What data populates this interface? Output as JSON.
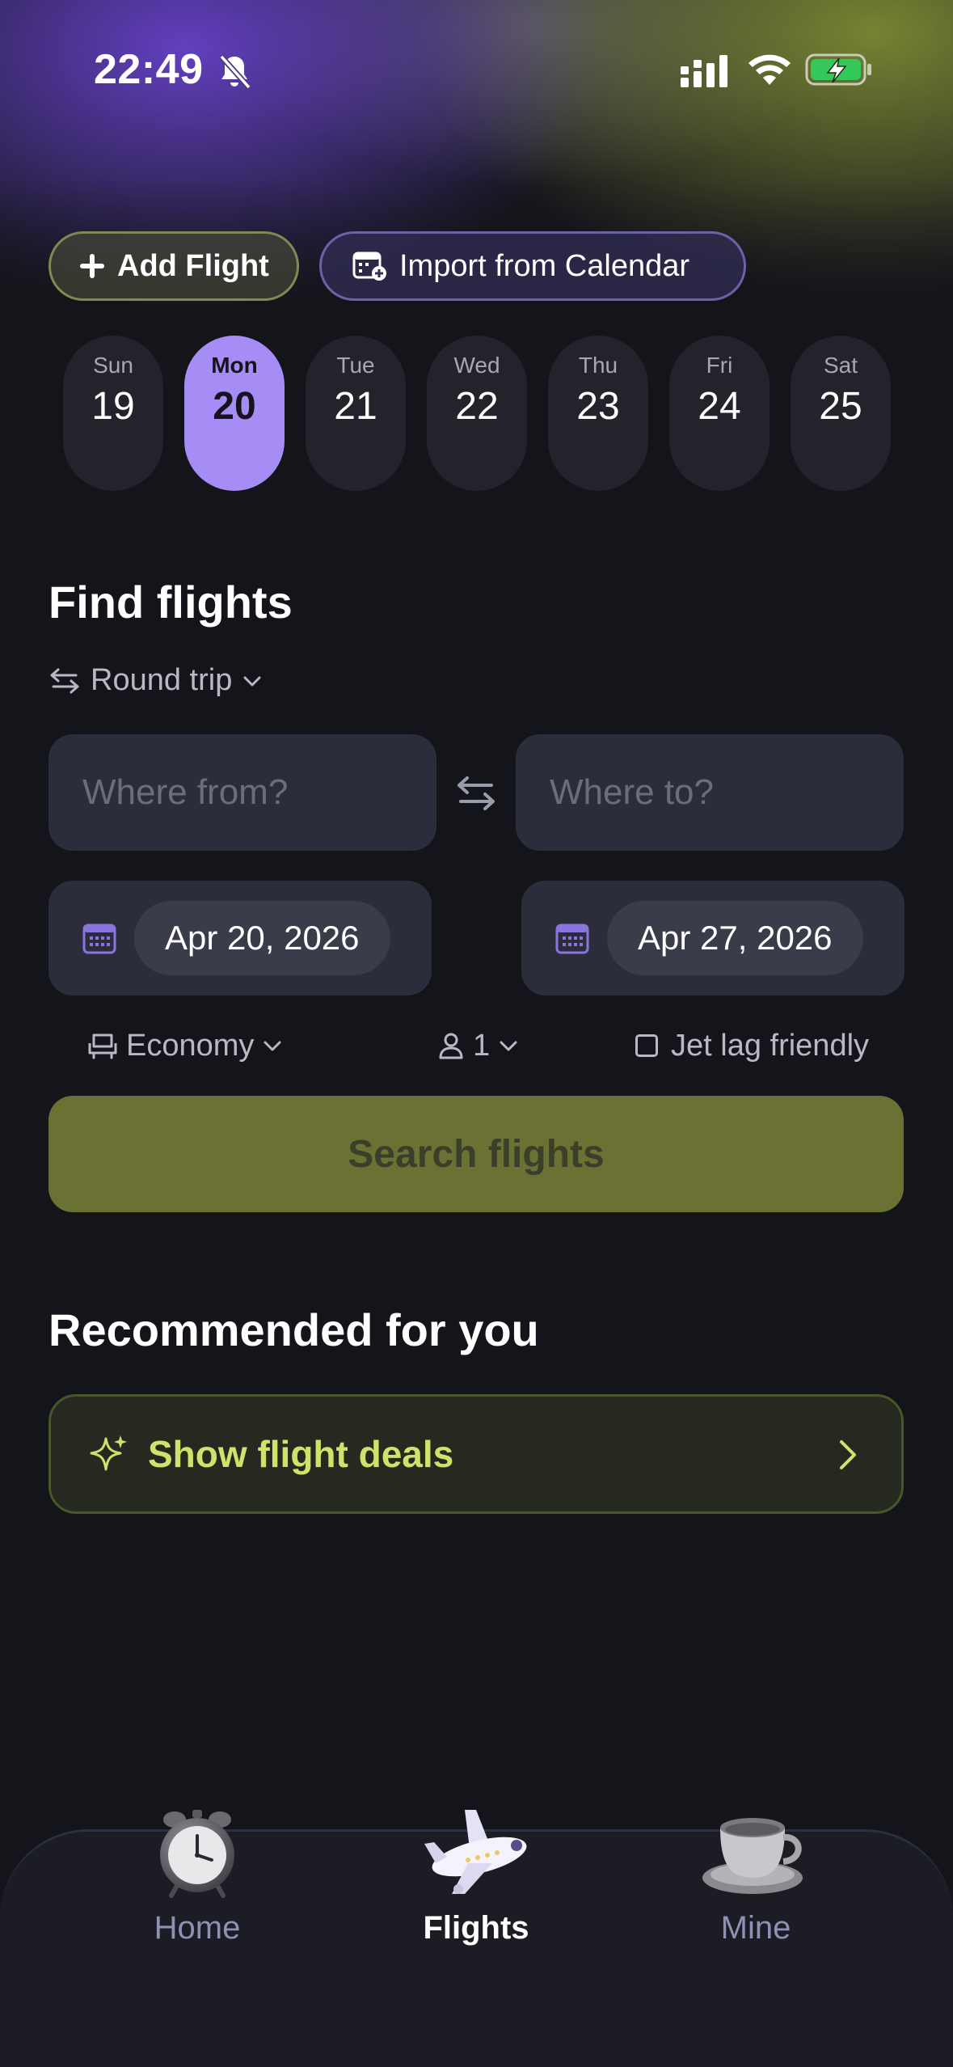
{
  "status_bar": {
    "time": "22:49",
    "icons": [
      "bell-slash-icon",
      "signal-icon",
      "wifi-icon",
      "battery-charging-icon"
    ],
    "battery_color": "#34c759"
  },
  "actions": {
    "add_flight": "Add Flight",
    "import_calendar": "Import from Calendar"
  },
  "days": [
    {
      "name": "Sun",
      "num": "19"
    },
    {
      "name": "Mon",
      "num": "20",
      "selected": true
    },
    {
      "name": "Tue",
      "num": "21"
    },
    {
      "name": "Wed",
      "num": "22"
    },
    {
      "name": "Thu",
      "num": "23"
    },
    {
      "name": "Fri",
      "num": "24"
    },
    {
      "name": "Sat",
      "num": "25"
    }
  ],
  "find_flights": {
    "title": "Find flights",
    "trip_type": "Round trip",
    "from_placeholder": "Where from?",
    "to_placeholder": "Where to?",
    "depart_date": "Apr 20, 2026",
    "return_date": "Apr 27, 2026",
    "cabin_class": "Economy",
    "passengers": "1",
    "jet_lag_label": "Jet lag friendly",
    "jet_lag_checked": false,
    "search_label": "Search flights"
  },
  "recommended": {
    "title": "Recommended for you",
    "deals_label": "Show flight deals"
  },
  "nav": {
    "home": "Home",
    "flights": "Flights",
    "mine": "Mine",
    "active": "flights"
  },
  "colors": {
    "accent_purple": "#a68cf5",
    "accent_olive": "#6a7133",
    "deals_text": "#cde36a",
    "background": "#14151b"
  }
}
